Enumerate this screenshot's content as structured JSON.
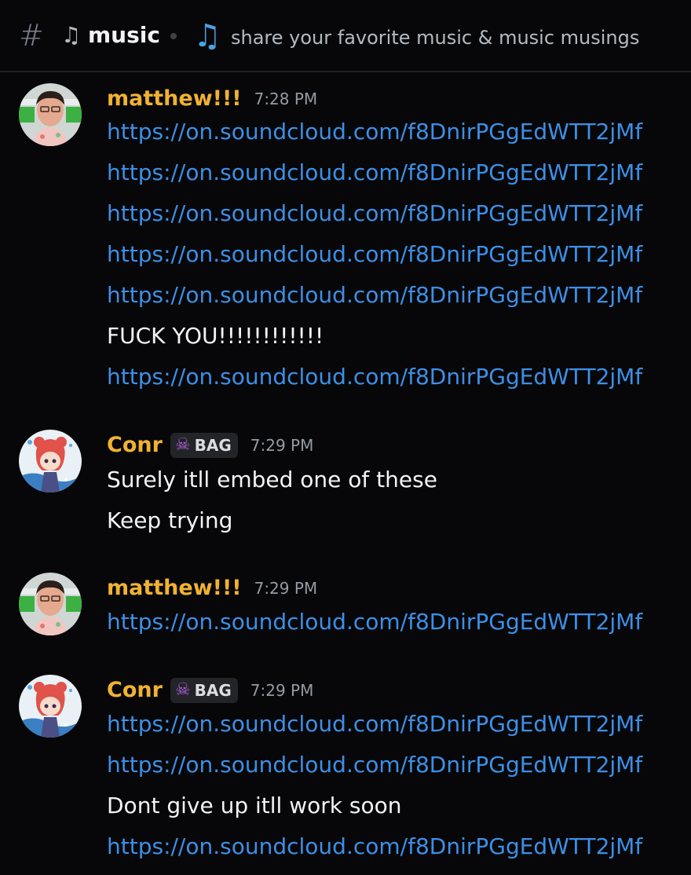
{
  "channel": {
    "hash_icon": "hash-icon",
    "note_icon": "music-note-icon",
    "name": "music",
    "topic_icon": "music-notes-icon",
    "topic": "share your favorite music & music musings"
  },
  "messages": [
    {
      "username": "matthew!!!",
      "timestamp": "7:28 PM",
      "avatar": "matthew-avatar",
      "lines": [
        "https://on.soundcloud.com/f8DnirPGgEdWTT2jMf",
        "https://on.soundcloud.com/f8DnirPGgEdWTT2jMf",
        "https://on.soundcloud.com/f8DnirPGgEdWTT2jMf",
        "https://on.soundcloud.com/f8DnirPGgEdWTT2jMf",
        "https://on.soundcloud.com/f8DnirPGgEdWTT2jMf",
        "FUCK YOU!!!!!!!!!!!!",
        "https://on.soundcloud.com/f8DnirPGgEdWTT2jMf"
      ]
    },
    {
      "username": "Conr",
      "tag": "BAG",
      "tag_icon": "skull-icon",
      "timestamp": "7:29 PM",
      "avatar": "conr-avatar",
      "lines": [
        "Surely itll embed one of these",
        "Keep trying"
      ]
    },
    {
      "username": "matthew!!!",
      "timestamp": "7:29 PM",
      "avatar": "matthew-avatar",
      "lines": [
        "https://on.soundcloud.com/f8DnirPGgEdWTT2jMf"
      ]
    },
    {
      "username": "Conr",
      "tag": "BAG",
      "tag_icon": "skull-icon",
      "timestamp": "7:29 PM",
      "avatar": "conr-avatar",
      "lines": [
        "https://on.soundcloud.com/f8DnirPGgEdWTT2jMf",
        "https://on.soundcloud.com/f8DnirPGgEdWTT2jMf",
        "Dont give up itll work soon",
        "https://on.soundcloud.com/f8DnirPGgEdWTT2jMf"
      ]
    }
  ],
  "colors": {
    "background": "#070709",
    "username": "#f0b232",
    "link": "#3d8fe6",
    "text": "#f2f3f5",
    "timestamp": "#949ba4"
  }
}
